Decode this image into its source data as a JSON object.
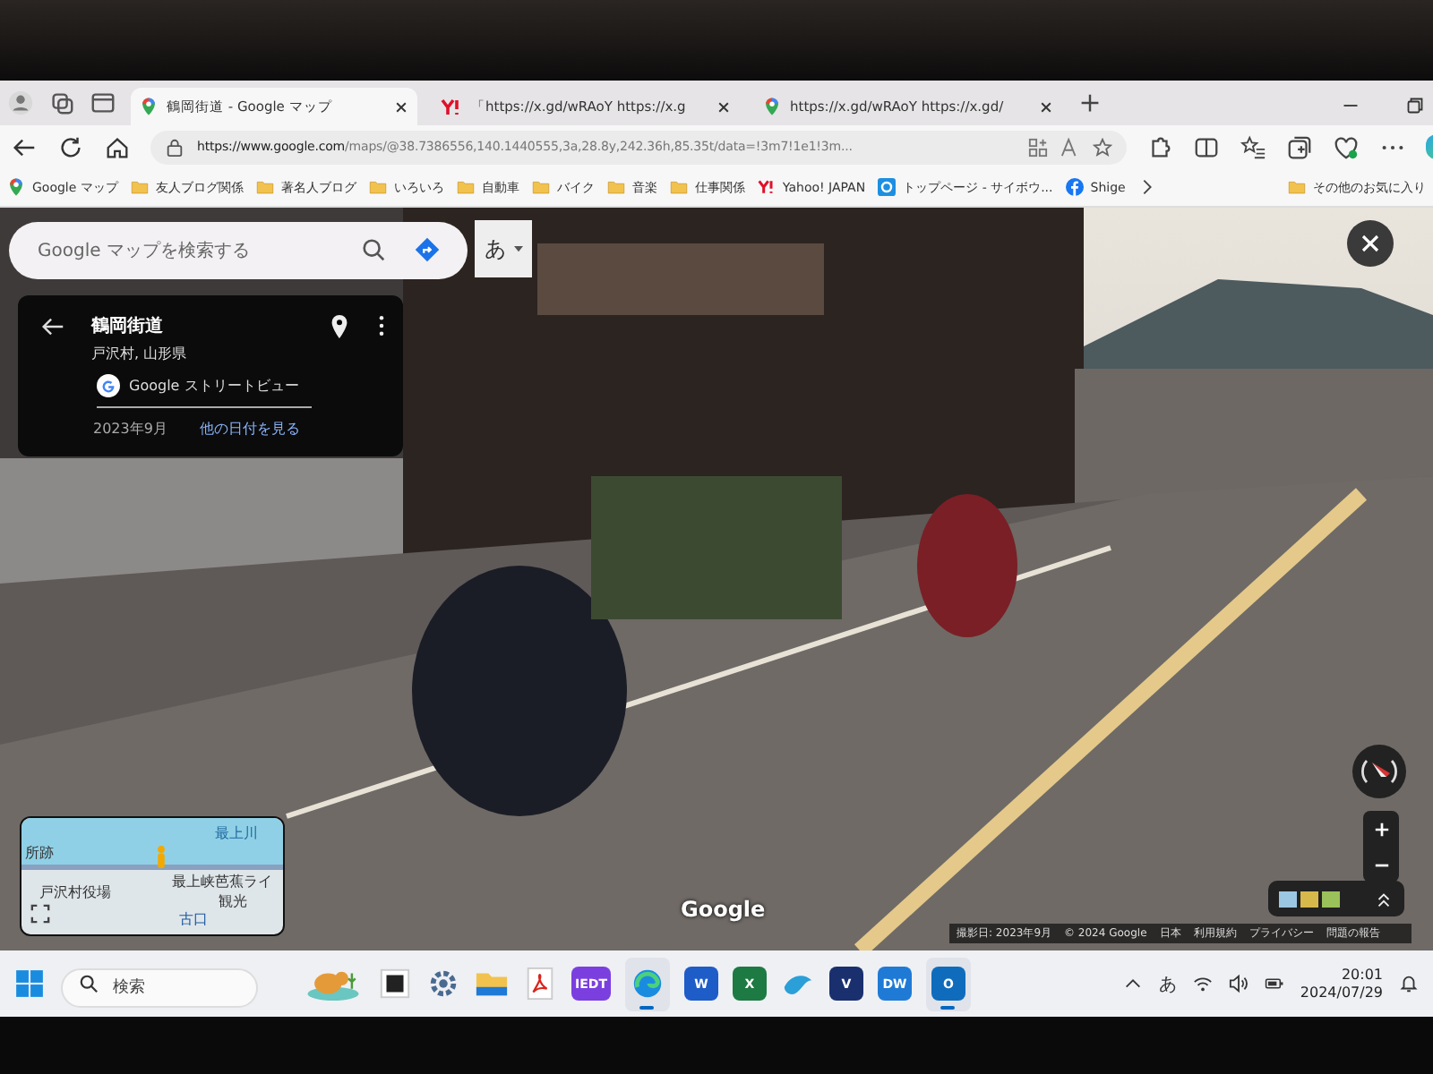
{
  "browser": {
    "tabs": [
      {
        "title": "鶴岡街道 - Google マップ",
        "kind": "maps",
        "selected": true
      },
      {
        "title": "「https://x.gd/wRAoY https://x.g",
        "kind": "yahoo",
        "selected": false
      },
      {
        "title": "https://x.gd/wRAoY https://x.gd/",
        "kind": "maps",
        "selected": false
      }
    ],
    "url_host": "https://www.google.com",
    "url_path": "/maps/@38.7386556,140.1440555,3a,28.8y,242.36h,85.35t/data=!3m7!1e1!3m...",
    "bookmarks": [
      {
        "label": "Google マップ",
        "kind": "maps"
      },
      {
        "label": "友人ブログ関係",
        "kind": "folder"
      },
      {
        "label": "著名人ブログ",
        "kind": "folder"
      },
      {
        "label": "いろいろ",
        "kind": "folder"
      },
      {
        "label": "自動車",
        "kind": "folder"
      },
      {
        "label": "バイク",
        "kind": "folder"
      },
      {
        "label": "音楽",
        "kind": "folder"
      },
      {
        "label": "仕事関係",
        "kind": "folder"
      },
      {
        "label": "Yahoo! JAPAN",
        "kind": "yahoo"
      },
      {
        "label": "トップページ - サイボウ...",
        "kind": "app"
      },
      {
        "label": "Shige",
        "kind": "facebook"
      }
    ],
    "other_favorites": "その他のお気に入り"
  },
  "maps": {
    "search": {
      "placeholder": "Google マップを検索する"
    },
    "ime": "あ",
    "place": {
      "title": "鶴岡街道",
      "subtitle": "戸沢村, 山形県",
      "source": "Google ストリートビュー",
      "date": "2023年9月",
      "link": "他の日付を見る"
    },
    "minimap": {
      "labels": [
        {
          "text": "最上川",
          "kind": "water"
        },
        {
          "text": "所跡",
          "kind": "place"
        },
        {
          "text": "戸沢村役場",
          "kind": "place"
        },
        {
          "text": "最上峡芭蕉ライ",
          "kind": "place"
        },
        {
          "text": "観光",
          "kind": "place"
        },
        {
          "text": "古口",
          "kind": "station"
        }
      ]
    },
    "logo": "Google",
    "footer": [
      "撮影日: 2023年9月",
      "© 2024 Google",
      "日本",
      "利用規約",
      "プライバシー",
      "問題の報告"
    ]
  },
  "taskbar": {
    "search": {
      "placeholder": "検索"
    },
    "apps": [
      {
        "kind": "widget",
        "running": false
      },
      {
        "kind": "square",
        "running": false
      },
      {
        "kind": "gear",
        "running": false
      },
      {
        "kind": "folder",
        "running": false
      },
      {
        "kind": "pdf",
        "running": false
      },
      {
        "kind": "badge",
        "label": "IEDT",
        "color": "#7b3fe0",
        "running": false
      },
      {
        "kind": "edge",
        "running": true
      },
      {
        "kind": "badge",
        "label": "W",
        "color": "#1e5cc8",
        "running": false
      },
      {
        "kind": "badge",
        "label": "X",
        "color": "#1d7a43",
        "running": false
      },
      {
        "kind": "bird",
        "running": false
      },
      {
        "kind": "badge",
        "label": "V",
        "color": "#1a2f6e",
        "running": false
      },
      {
        "kind": "badge",
        "label": "DW",
        "color": "#1f7ad6",
        "running": false
      },
      {
        "kind": "badge",
        "label": "O",
        "color": "#0f6cbd",
        "running": true
      }
    ],
    "ime": "あ",
    "time": "20:01",
    "date": "2024/07/29"
  }
}
